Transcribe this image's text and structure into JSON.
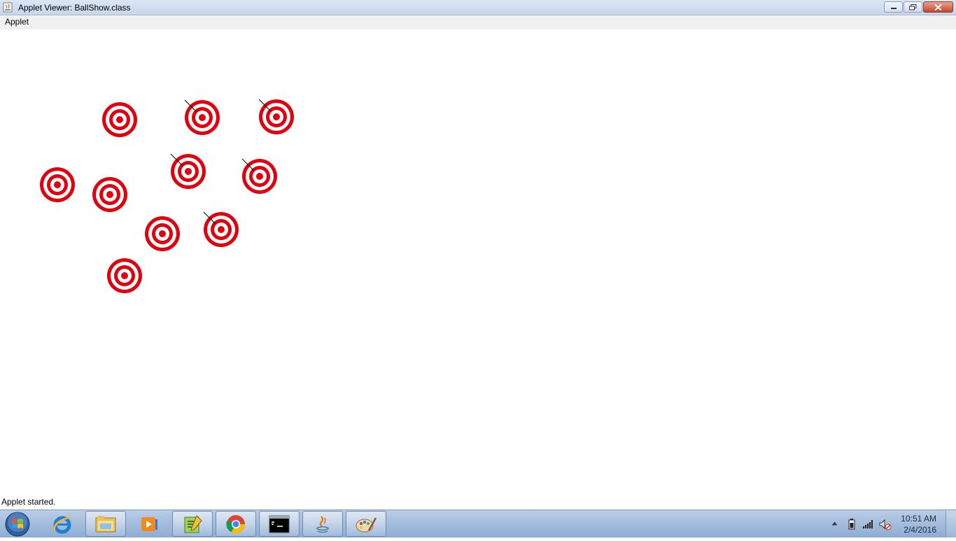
{
  "window": {
    "title": "Applet Viewer: BallShow.class",
    "icon": "java-applet-icon",
    "controls": [
      "minimize-icon",
      "restore-icon",
      "close-icon"
    ]
  },
  "menubar": {
    "items": [
      {
        "label": "Applet"
      }
    ]
  },
  "status": {
    "text": "Applet started."
  },
  "canvas": {
    "ring_colors": {
      "red": "#e0000e",
      "white": "#ffffff"
    },
    "balls": [
      {
        "shows_direction_line": false
      },
      {
        "shows_direction_line": true
      },
      {
        "shows_direction_line": true
      },
      {
        "shows_direction_line": true
      },
      {
        "shows_direction_line": true
      },
      {
        "shows_direction_line": false
      },
      {
        "shows_direction_line": false
      },
      {
        "shows_direction_line": false
      },
      {
        "shows_direction_line": true
      },
      {
        "shows_direction_line": false
      }
    ]
  },
  "taskbar": {
    "start": "windows-start-icon",
    "apps": [
      {
        "icon": "internet-explorer-icon",
        "active": false
      },
      {
        "icon": "file-explorer-icon",
        "active": true
      },
      {
        "icon": "media-player-icon",
        "active": false
      },
      {
        "icon": "notepad-plus-plus-icon",
        "active": true
      },
      {
        "icon": "chrome-icon",
        "active": true
      },
      {
        "icon": "command-prompt-icon",
        "active": true
      },
      {
        "icon": "java-icon",
        "active": true
      },
      {
        "icon": "paint-icon",
        "active": true
      }
    ],
    "tray": [
      "show-hidden-icons-icon",
      "battery-icon",
      "network-signal-icon",
      "volume-muted-icon"
    ],
    "clock": {
      "time": "10:51 AM",
      "date": "2/4/2016"
    }
  }
}
